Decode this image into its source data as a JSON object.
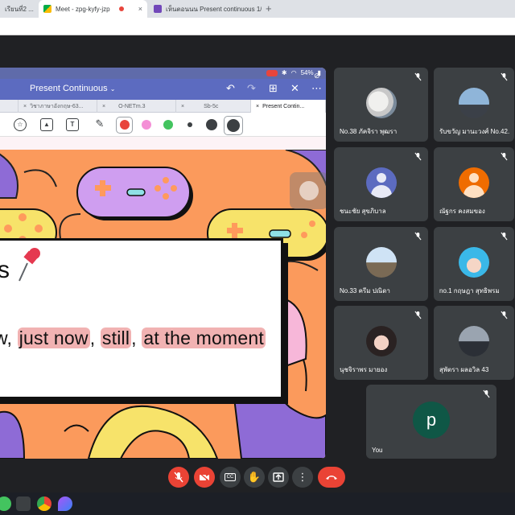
{
  "browser": {
    "tabs": [
      {
        "title": "เรียนที่2 ...",
        "close": "×"
      },
      {
        "title": "Meet - zpg-kyfy-jzp",
        "close": "×"
      },
      {
        "title": "เห็นตอนนน Present continuous 1/8",
        "close": "×"
      }
    ],
    "new_tab": "+"
  },
  "slides_app": {
    "status": {
      "battery": "54%"
    },
    "title": "Present Continuous",
    "title_chevron": "⌄",
    "doc_tabs": [
      {
        "label": "วิชาภาษาอังกฤษ-63..."
      },
      {
        "label": "O-NETm.3"
      },
      {
        "label": "Sb-5c"
      },
      {
        "label": "Present Contin..."
      }
    ],
    "toolbar": {
      "text_tool": "T"
    },
    "colors": {
      "red": "#e8453c",
      "pink": "#f48fd6",
      "green": "#43c45f",
      "dark": "#3c4043"
    },
    "slide": {
      "heading_fragment": "s",
      "line_prefix": "w, ",
      "kw1": "just now",
      "sep1": ", ",
      "kw2": "still",
      "sep2": ", ",
      "kw3": "at the moment"
    }
  },
  "participants": [
    {
      "name": "No.38 ภัคจิรา พุฒรา",
      "avatar": "cat-photo"
    },
    {
      "name": "รับขวัญ มานะวงศ์ No.42.",
      "avatar": "sky-photo"
    },
    {
      "name": "ชนะชัย สุขภิบาล",
      "avatar": "default-avatar",
      "color": "#5c6bc0"
    },
    {
      "name": "ณัฐกร คงสมของ",
      "avatar": "default-avatar",
      "color": "#ef6c00"
    },
    {
      "name": "No.33 ครีม ปณิดา",
      "avatar": "outdoor-photo"
    },
    {
      "name": "no.1 กฤษฎา สุทธิพรม",
      "avatar": "anime-photo"
    },
    {
      "name": "นุชจิราพร มายอง",
      "avatar": "girl-photo"
    },
    {
      "name": "สุพัตรา ผลอวิล 43",
      "avatar": "dusk-photo"
    },
    {
      "name": "You",
      "avatar": "letter-avatar",
      "initial": "p",
      "color": "#0f5746"
    }
  ]
}
